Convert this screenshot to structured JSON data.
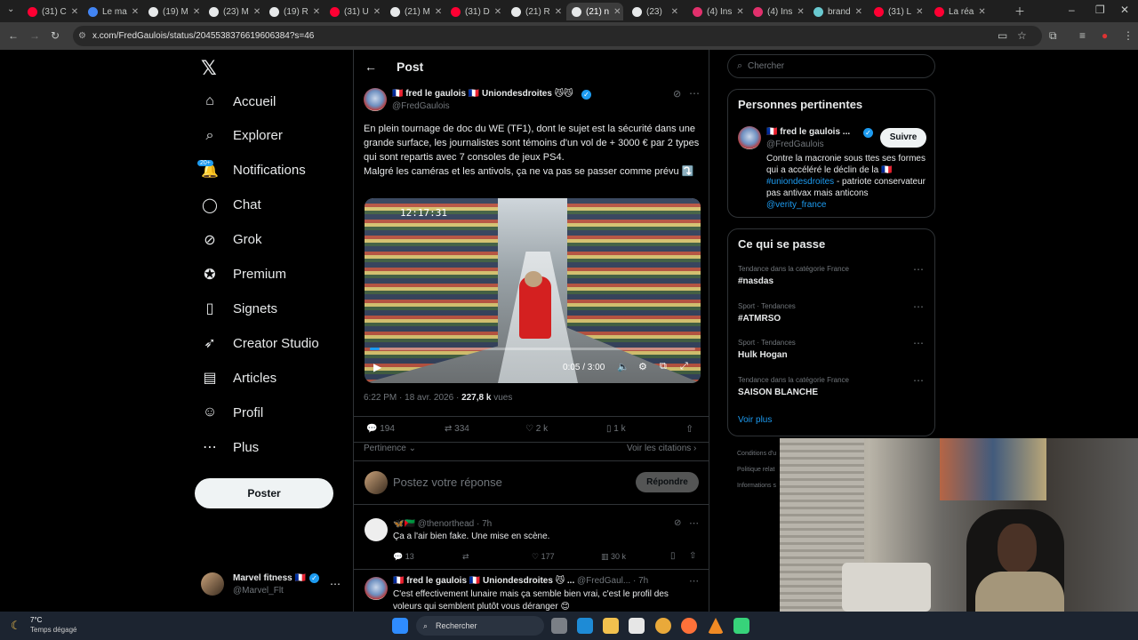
{
  "browser": {
    "tabs": [
      {
        "label": "(31) C",
        "color": "#ff0033"
      },
      {
        "label": "Le ma",
        "color": "#4285f4"
      },
      {
        "label": "(19) M",
        "color": "#e7e9ea"
      },
      {
        "label": "(23) M",
        "color": "#e7e9ea"
      },
      {
        "label": "(19) R",
        "color": "#e7e9ea"
      },
      {
        "label": "(31) U",
        "color": "#ff0033"
      },
      {
        "label": "(21) M",
        "color": "#e7e9ea"
      },
      {
        "label": "(31) D",
        "color": "#ff0033"
      },
      {
        "label": "(21) R",
        "color": "#e7e9ea"
      },
      {
        "label": "(21) n",
        "color": "#e7e9ea"
      },
      {
        "label": "(23)",
        "color": "#e7e9ea"
      },
      {
        "label": "(4) Ins",
        "color": "#e1306c"
      },
      {
        "label": "(4) Ins",
        "color": "#e1306c"
      },
      {
        "label": "brand",
        "color": "#69c9d0"
      },
      {
        "label": "(31) L",
        "color": "#ff0033"
      },
      {
        "label": "La réa",
        "color": "#ff0033"
      }
    ],
    "url": "x.com/FredGaulois/status/2045538376619606384?s=46"
  },
  "sidebar": {
    "logo": "𝕏",
    "items": [
      {
        "label": "Accueil",
        "icon": "home-icon",
        "glyph": "⌂"
      },
      {
        "label": "Explorer",
        "icon": "search-icon",
        "glyph": "⌕"
      },
      {
        "label": "Notifications",
        "icon": "bell-icon",
        "glyph": "🔔",
        "badge": "20+"
      },
      {
        "label": "Chat",
        "icon": "chat-icon",
        "glyph": "◯"
      },
      {
        "label": "Grok",
        "icon": "grok-icon",
        "glyph": "⊘"
      },
      {
        "label": "Premium",
        "icon": "premium-icon",
        "glyph": "✪"
      },
      {
        "label": "Signets",
        "icon": "bookmark-icon",
        "glyph": "▯"
      },
      {
        "label": "Creator Studio",
        "icon": "rocket-icon",
        "glyph": "➶"
      },
      {
        "label": "Articles",
        "icon": "article-icon",
        "glyph": "▤"
      },
      {
        "label": "Profil",
        "icon": "profile-icon",
        "glyph": "☺"
      },
      {
        "label": "Plus",
        "icon": "more-icon",
        "glyph": "⋯"
      }
    ],
    "post_button": "Poster",
    "account": {
      "name": "Marvel fitness 🇫🇷",
      "handle": "@Marvel_Flt"
    }
  },
  "header": {
    "title": "Post"
  },
  "post": {
    "author": "🇫🇷 fred le gaulois 🇫🇷 Uniondesdroites 😼😼",
    "handle": "@FredGaulois",
    "text": "En plein tournage de doc du WE (TF1), dont le sujet est la sécurité dans une grande surface, les journalistes sont témoins d'un vol de + 3000 € par 2 types qui sont repartis avec 7 consoles de jeux PS4.\nMalgré les caméras et les antivols, ça ne va pas se passer comme prévu ⤵️",
    "video": {
      "time": "0:05 / 3:00",
      "progress_fraction": 0.03,
      "overlay_text": "12:17:31"
    },
    "timestamp": "6:22 PM · 18 avr. 2026 · ",
    "views": "227,8 k",
    "views_label": " vues",
    "stats": {
      "replies": "194",
      "reposts": "334",
      "likes": "2 k",
      "bookmarks": "1 k"
    },
    "sort_label": "Pertinence",
    "quotes_label": "Voir les citations",
    "reply_placeholder": "Postez votre réponse",
    "reply_button": "Répondre"
  },
  "replies": [
    {
      "author": "🦋🇲🇶",
      "handle": "@thenorthead",
      "time": "· 7h",
      "text": "Ça a l'air bien fake. Une mise en scène.",
      "stats": {
        "replies": "13",
        "reposts": "",
        "likes": "177",
        "views": "30 k"
      }
    },
    {
      "author": "🇫🇷 fred le gaulois 🇫🇷 Uniondesdroites 😼 ...",
      "handle": "@FredGaul...",
      "time": "· 7h",
      "text": "C'est effectivement lunaire mais ça semble bien vrai, c'est le profil des voleurs qui semblent plutôt vous déranger 😊"
    }
  ],
  "search": {
    "placeholder": "Chercher"
  },
  "relevant": {
    "title": "Personnes pertinentes",
    "name": "🇫🇷 fred le gaulois ...",
    "handle": "@FredGaulois",
    "follow": "Suivre",
    "bio_1": "Contre la macronie sous ttes ses formes qui a accéléré le déclin de la 🇫🇷 ",
    "bio_tag": "#uniondesdroites",
    "bio_2": " - patriote conservateur pas antivax mais anticons ",
    "bio_mention": "@verity_france"
  },
  "trends": {
    "title": "Ce qui se passe",
    "items": [
      {
        "category": "Tendance dans la catégorie France",
        "name": "#nasdas"
      },
      {
        "category": "Sport · Tendances",
        "name": "#ATMRSO"
      },
      {
        "category": "Sport · Tendances",
        "name": "Hulk Hogan"
      },
      {
        "category": "Tendance dans la catégorie France",
        "name": "SAISON BLANCHE"
      }
    ],
    "more": "Voir plus"
  },
  "footer_links": [
    "Conditions d'u",
    "Politique relat",
    "Informations s"
  ],
  "taskbar": {
    "weather_temp": "7°C",
    "weather_desc": "Temps dégagé",
    "search": "Rechercher"
  }
}
